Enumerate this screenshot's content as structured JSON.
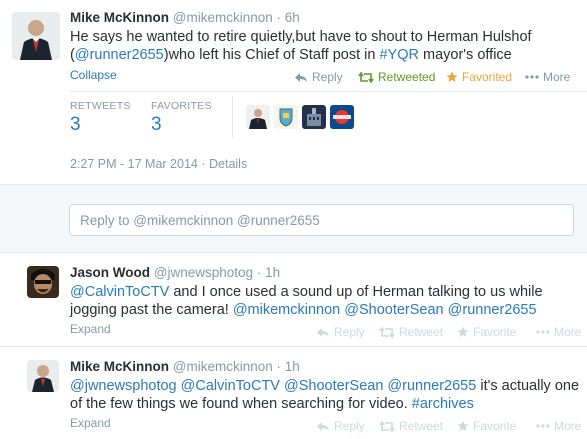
{
  "main_tweet": {
    "name": "Mike McKinnon",
    "handle": "@mikemckinnon",
    "time": "· 6h",
    "line1": "He says he wanted to retire quietly,but have to shout to Herman Hulshof",
    "line2_prefix": "(",
    "line2_mention": "@runner2655",
    "line2_middle": ")who left his Chief of Staff post in ",
    "line2_hashtag": "#YQR",
    "line2_suffix": " mayor's office",
    "collapse": "Collapse",
    "reply": "Reply",
    "retweeted": "Retweeted",
    "favorited": "Favorited",
    "more": "More",
    "retweets_label": "RETWEETS",
    "retweets_count": "3",
    "favorites_label": "FAVORITES",
    "favorites_count": "3",
    "timestamp": "2:27 PM - 17 Mar 2014",
    "dot": "·",
    "details": "Details",
    "reply_placeholder": "Reply to @mikemckinnon @runner2655"
  },
  "replies": [
    {
      "name": "Jason Wood",
      "handle": "@jwnewsphotog",
      "time": "· 1h",
      "mention1": "@CalvinToCTV",
      "text1": " and I once used a sound up of Herman talking to us while",
      "text2": "jogging past the camera! ",
      "mention2": "@mikemckinnon",
      "mention3": "@ShooterSean",
      "mention4": "@runner2655",
      "expand": "Expand",
      "reply": "Reply",
      "retweet": "Retweet",
      "favorite": "Favorite",
      "more": "More"
    },
    {
      "name": "Mike McKinnon",
      "handle": "@mikemckinnon",
      "time": "· 1h",
      "mention1": "@jwnewsphotog",
      "mention2": "@CalvinToCTV",
      "mention3": "@ShooterSean",
      "mention4": "@runner2655",
      "text1": " it's actually one",
      "text2": "of the few things we found when searching for video. ",
      "hashtag": "#archives",
      "expand": "Expand",
      "reply": "Reply",
      "retweet": "Retweet",
      "favorite": "Favorite",
      "more": "More"
    }
  ],
  "colors": {
    "link": "#2b7bb9",
    "retweeted": "#609928",
    "favorited": "#e8a53a",
    "muted": "#8899a6"
  }
}
